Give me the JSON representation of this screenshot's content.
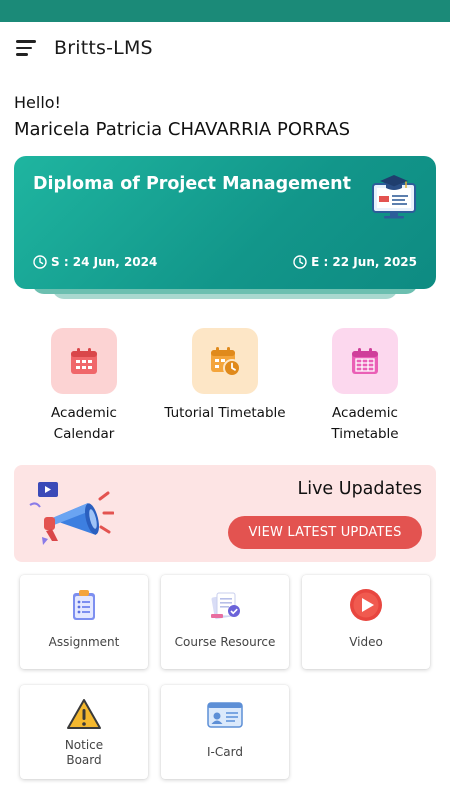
{
  "app": {
    "title": "Britts-LMS"
  },
  "greeting": {
    "hello": "Hello!",
    "name": "Maricela Patricia CHAVARRIA PORRAS"
  },
  "course": {
    "title": "Diploma of Project Management",
    "start": "S : 24 Jun, 2024",
    "end": "E : 22 Jun, 2025"
  },
  "quick_links": [
    {
      "label": "Academic Calendar",
      "icon": "calendar-icon",
      "color": "#f0676a"
    },
    {
      "label": "Tutorial Timetable",
      "icon": "calendar-clock-icon",
      "color": "#f4a53c"
    },
    {
      "label": "Academic Timetable",
      "icon": "timetable-icon",
      "color": "#ea5fb6"
    }
  ],
  "live_updates": {
    "title": "Live Upadates",
    "button": "VIEW LATEST UPDATES"
  },
  "modules": [
    {
      "label": "Assignment",
      "icon": "clipboard-icon"
    },
    {
      "label": "Course Resource",
      "icon": "documents-icon"
    },
    {
      "label": "Video",
      "icon": "play-icon"
    },
    {
      "label": "Notice Board",
      "icon": "warning-icon"
    },
    {
      "label": "I-Card",
      "icon": "id-card-icon"
    }
  ],
  "colors": {
    "primary": "#1b8a78",
    "accent_red": "#e35350",
    "live_bg": "#fde4e4"
  }
}
